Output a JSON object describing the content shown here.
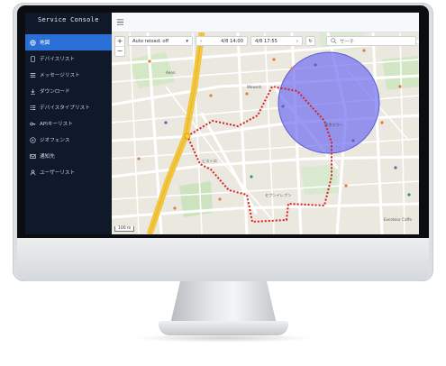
{
  "app": {
    "title": "Service Console"
  },
  "sidebar": {
    "items": [
      {
        "label": "地図",
        "icon": "globe-icon",
        "active": true
      },
      {
        "label": "デバイスリスト",
        "icon": "device-list-icon",
        "active": false
      },
      {
        "label": "メッセージリスト",
        "icon": "message-list-icon",
        "active": false
      },
      {
        "label": "ダウンロード",
        "icon": "download-icon",
        "active": false
      },
      {
        "label": "デバイスタイプリスト",
        "icon": "device-type-list-icon",
        "active": false
      },
      {
        "label": "APIキーリスト",
        "icon": "key-icon",
        "active": false
      },
      {
        "label": "ジオフェンス",
        "icon": "geofence-icon",
        "active": false
      },
      {
        "label": "通知先",
        "icon": "notification-icon",
        "active": false
      },
      {
        "label": "ユーザーリスト",
        "icon": "user-icon",
        "active": false
      }
    ]
  },
  "toolbar": {
    "auto_reload_label": "Auto reload: off",
    "date_from": "4/8 14:00",
    "date_to": "4/8 17:55",
    "search_placeholder": "サーチ"
  },
  "map": {
    "zoom_in": "+",
    "zoom_out": "−",
    "scale_label": "100 m",
    "labels": [
      {
        "text": "Aeon",
        "cls": "l1"
      },
      {
        "text": "Wework",
        "cls": "l2"
      },
      {
        "text": "ビストロ",
        "cls": "l3"
      },
      {
        "text": "東京タワー",
        "cls": "l4"
      },
      {
        "text": "セブンイレブン",
        "cls": "l5"
      },
      {
        "text": "Excelsior Caffe",
        "cls": "l6"
      }
    ]
  },
  "colors": {
    "sidebar_bg": "#10192a",
    "active_item": "#2a6fd6",
    "route": "#d81e1e",
    "geofence_fill": "#6f6ef0",
    "road_major": "#f3c63f"
  }
}
